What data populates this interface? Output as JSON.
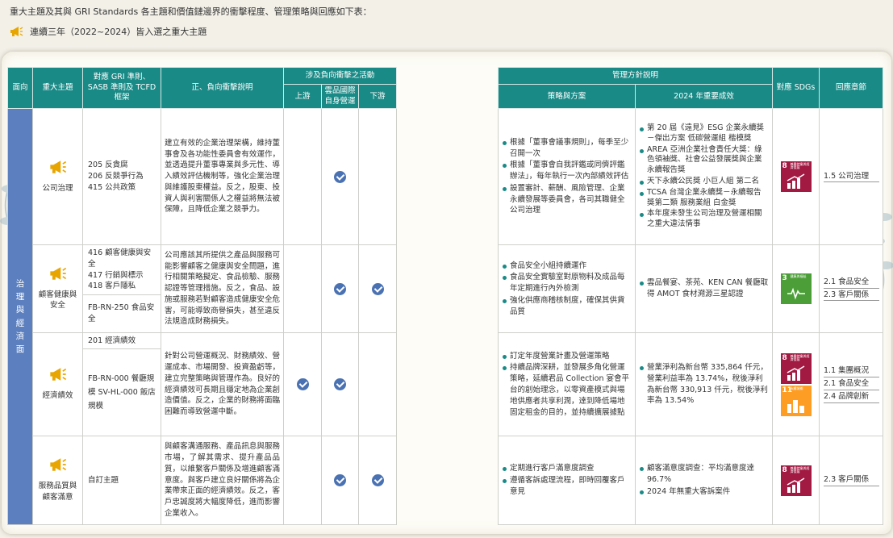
{
  "intro": "重大主題及其與 GRI Standards 各主題和價值鏈邊界的衝擊程度、管理策略與回應如下表：",
  "note": "連續三年（2022~2024）皆入選之重大主題",
  "icons": {
    "note": "megaphone-icon",
    "topic": "megaphone-icon",
    "check": "check-circle-icon"
  },
  "colors": {
    "header": "#1a8a86",
    "face": "#5b7fbf",
    "check": "#4a72b2",
    "icon": "#e8a500",
    "sdg8": "#a21942",
    "sdg3": "#4c9f38",
    "sdg11": "#fd9d24"
  },
  "left_headers": {
    "face": "面向",
    "topic": "重大主題",
    "gri": "對應 GRI 準則、SASB 準則及 TCFD 框架",
    "impact": "正、負向衝擊說明",
    "involve": "涉及負向衝擊之活動",
    "upstream": "上游",
    "self": "雲品國際自身營運",
    "downstream": "下游"
  },
  "right_headers": {
    "mgmt": "管理方針說明",
    "strategy": "策略與方案",
    "results": "2024 年重要成效",
    "sdgs": "對應 SDGs",
    "chapter": "回應章節"
  },
  "face": "治理與經濟面",
  "sdg_labels": {
    "sdg8": {
      "num": "8",
      "label": "尊嚴就業與經濟發展"
    },
    "sdg3": {
      "num": "3",
      "label": "健康與福祉"
    },
    "sdg11": {
      "num": "11",
      "label": "永續城鄉"
    }
  },
  "rows": [
    {
      "topic": "公司治理",
      "gri": [
        "205 反貪腐",
        "206 反競爭行為",
        "415 公共政策"
      ],
      "impact": "建立有效的企業治理架構，維持董事會及各功能性委員會有效運作，並透過提升董事專業與多元性、導入績效評估機制等，強化企業治理與維護股東權益。反之，股東、投資人與利害關係人之權益將無法被保障，且降低企業之競爭力。",
      "strategy": [
        "根據「董事會議事規則」，每季至少召開一次",
        "根據「董事會自我評鑑或同儕評鑑辦法」，每年執行一次內部績效評估",
        "設置審計、薪酬、風險管理、企業永續發展等委員會，各司其職健全公司治理"
      ],
      "results": [
        "第 20 屆《遠見》ESG 企業永續獎－傑出方案 低碳營運組 楷模獎",
        "AREA 亞洲企業社會責任大獎：綠色領袖獎、社會公益發展獎與企業永續報告獎",
        "天下永續公民獎 小巨人組 第二名",
        "TCSA 台灣企業永續獎－永續報告獎第二類 服務業組 白金獎",
        "本年度未發生公司治理及營運相關之重大違法情事"
      ],
      "chapters": [
        "1.5 公司治理"
      ]
    },
    {
      "topic": "顧客健康與安全",
      "gri": [
        "416 顧客健康與安全",
        "417 行銷與標示",
        "418 客戶隱私"
      ],
      "sasb": "FB-RN-250 食品安全",
      "impact": "公司應該其所提供之產品與服務可能影響顧客之健康與安全問題，進行相關策略擬定、食品檢驗、服務認證等管理措施。反之，食品、設施或服務若對顧客造成健康安全危害，可能導致商譽損失，甚至違反法規造成財務損失。",
      "strategy": [
        "食品安全小組持續運作",
        "食品安全實驗室對原物料及成品每年定期進行內外檢測",
        "強化供應商稽核制度，確保其供貨品質"
      ],
      "results": [
        "雲品餐宴、茶苑、KEN CAN 餐廳取得 AMOT 食材溯源三星認證"
      ],
      "chapters": [
        "2.1 食品安全",
        "2.3 客戶關係"
      ]
    },
    {
      "topic": "經濟績效",
      "gri": [
        "201 經濟績效"
      ],
      "sasb": "FB-RN-000 餐廳規模 SV-HL-000 飯店規模",
      "impact": "針對公司營運概況、財務績效、營運成本、市場開發、投資盈虧等，建立完整策略與管理作為。良好的經濟績效可長期且穩定地為企業創造價值。反之，企業的財務將面臨困難而導致營運中斷。",
      "strategy": [
        "訂定年度營業計畫及營運策略",
        "持續品牌深耕，並發展多角化營運策略，延續君品 Collection 宴會平台的創始理念，以零資產模式與場地供應者共享利潤，達到降低場地固定租金的目的，並持續擴展據點"
      ],
      "results": [
        "營業淨利為新台幣 335,864 仟元，營業利益率為 13.74%，稅後淨利為新台幣 330,913 仟元，稅後淨利率為 13.54%"
      ],
      "chapters": [
        "1.1 集團概況",
        "2.1 食品安全",
        "2.4 品牌創新"
      ]
    },
    {
      "topic": "服務品質與顧客滿意",
      "gri": [
        "自訂主題"
      ],
      "impact": "與顧客溝通服務、產品訊息與服務市場，了解其需求、提升產品品質，以維繫客戶關係及增進顧客滿意度。與客戶建立良好關係將為企業帶來正面的經濟績效。反之，客戶忠誠度將大幅度降低，進而影響企業收入。",
      "strategy": [
        "定期進行客戶滿意度調查",
        "遵循客訴處理流程，即時回覆客戶意見"
      ],
      "results": [
        "顧客滿意度調查：平均滿意度達 96.7%",
        "2024 年無重大客訴案件"
      ],
      "chapters": [
        "2.3 客戶關係"
      ]
    }
  ]
}
